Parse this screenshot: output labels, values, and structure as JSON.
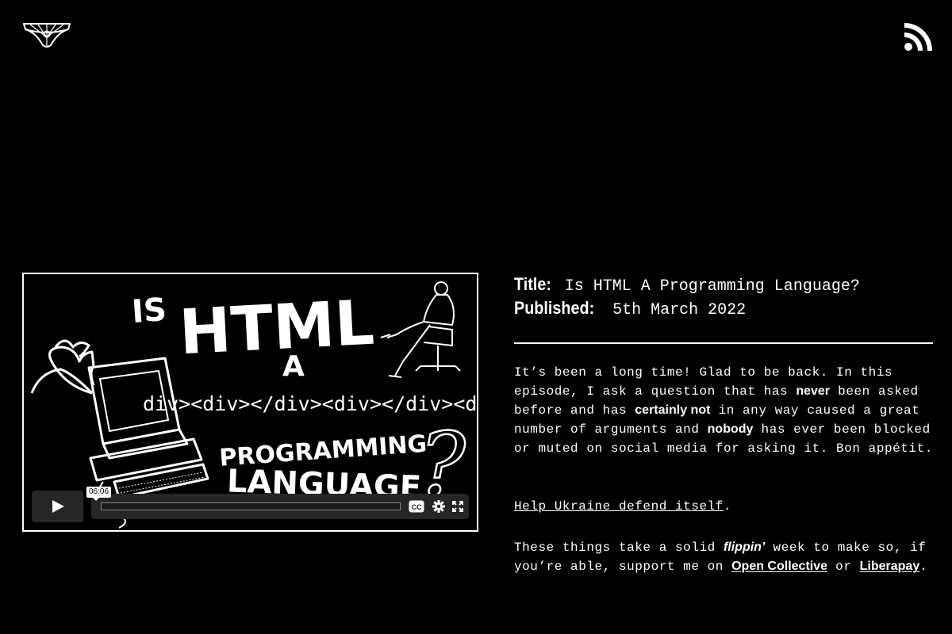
{
  "header": {
    "logo_icon": "underwear-web-logo-icon",
    "rss_icon": "rss-feed-icon"
  },
  "video": {
    "thumbnail": {
      "line_is": "IS",
      "line_html": "HTML",
      "line_a": "A",
      "code_strip": "div><div></div><div></div><div",
      "line_programming": "PROGRAMMING",
      "line_language": "LANGUAGE",
      "question_mark": "?"
    },
    "timecode": "06:06",
    "progress": 0,
    "controls": {
      "play_icon": "play-icon",
      "cc_icon": "closed-captions-icon",
      "settings_icon": "gear-icon",
      "fullscreen_icon": "fullscreen-icon"
    }
  },
  "episode": {
    "title_label": "Title:",
    "title_value": "Is HTML A Programming Language?",
    "published_label": "Published:",
    "published_value": "5th March 2022"
  },
  "description": {
    "p1_a": "It’s been a long time! Glad to be back. In this episode, I ask a question that has ",
    "p1_b": "never",
    "p1_c": " been asked before and has ",
    "p1_d": "certainly not",
    "p1_e": " in any way caused a great number of arguments and ",
    "p1_f": "nobody",
    "p1_g": " has ever been blocked or muted on social media for asking it. Bon appétit.",
    "p2_link": "Help Ukraine defend itself",
    "p2_end": ".",
    "p3_a": "These things take a solid ",
    "p3_b": "flippin’",
    "p3_c": " week to make so, if you’re able, support me on ",
    "p3_link1": "Open Collective",
    "p3_d": " or ",
    "p3_link2": "Liberapay",
    "p3_end": "."
  }
}
